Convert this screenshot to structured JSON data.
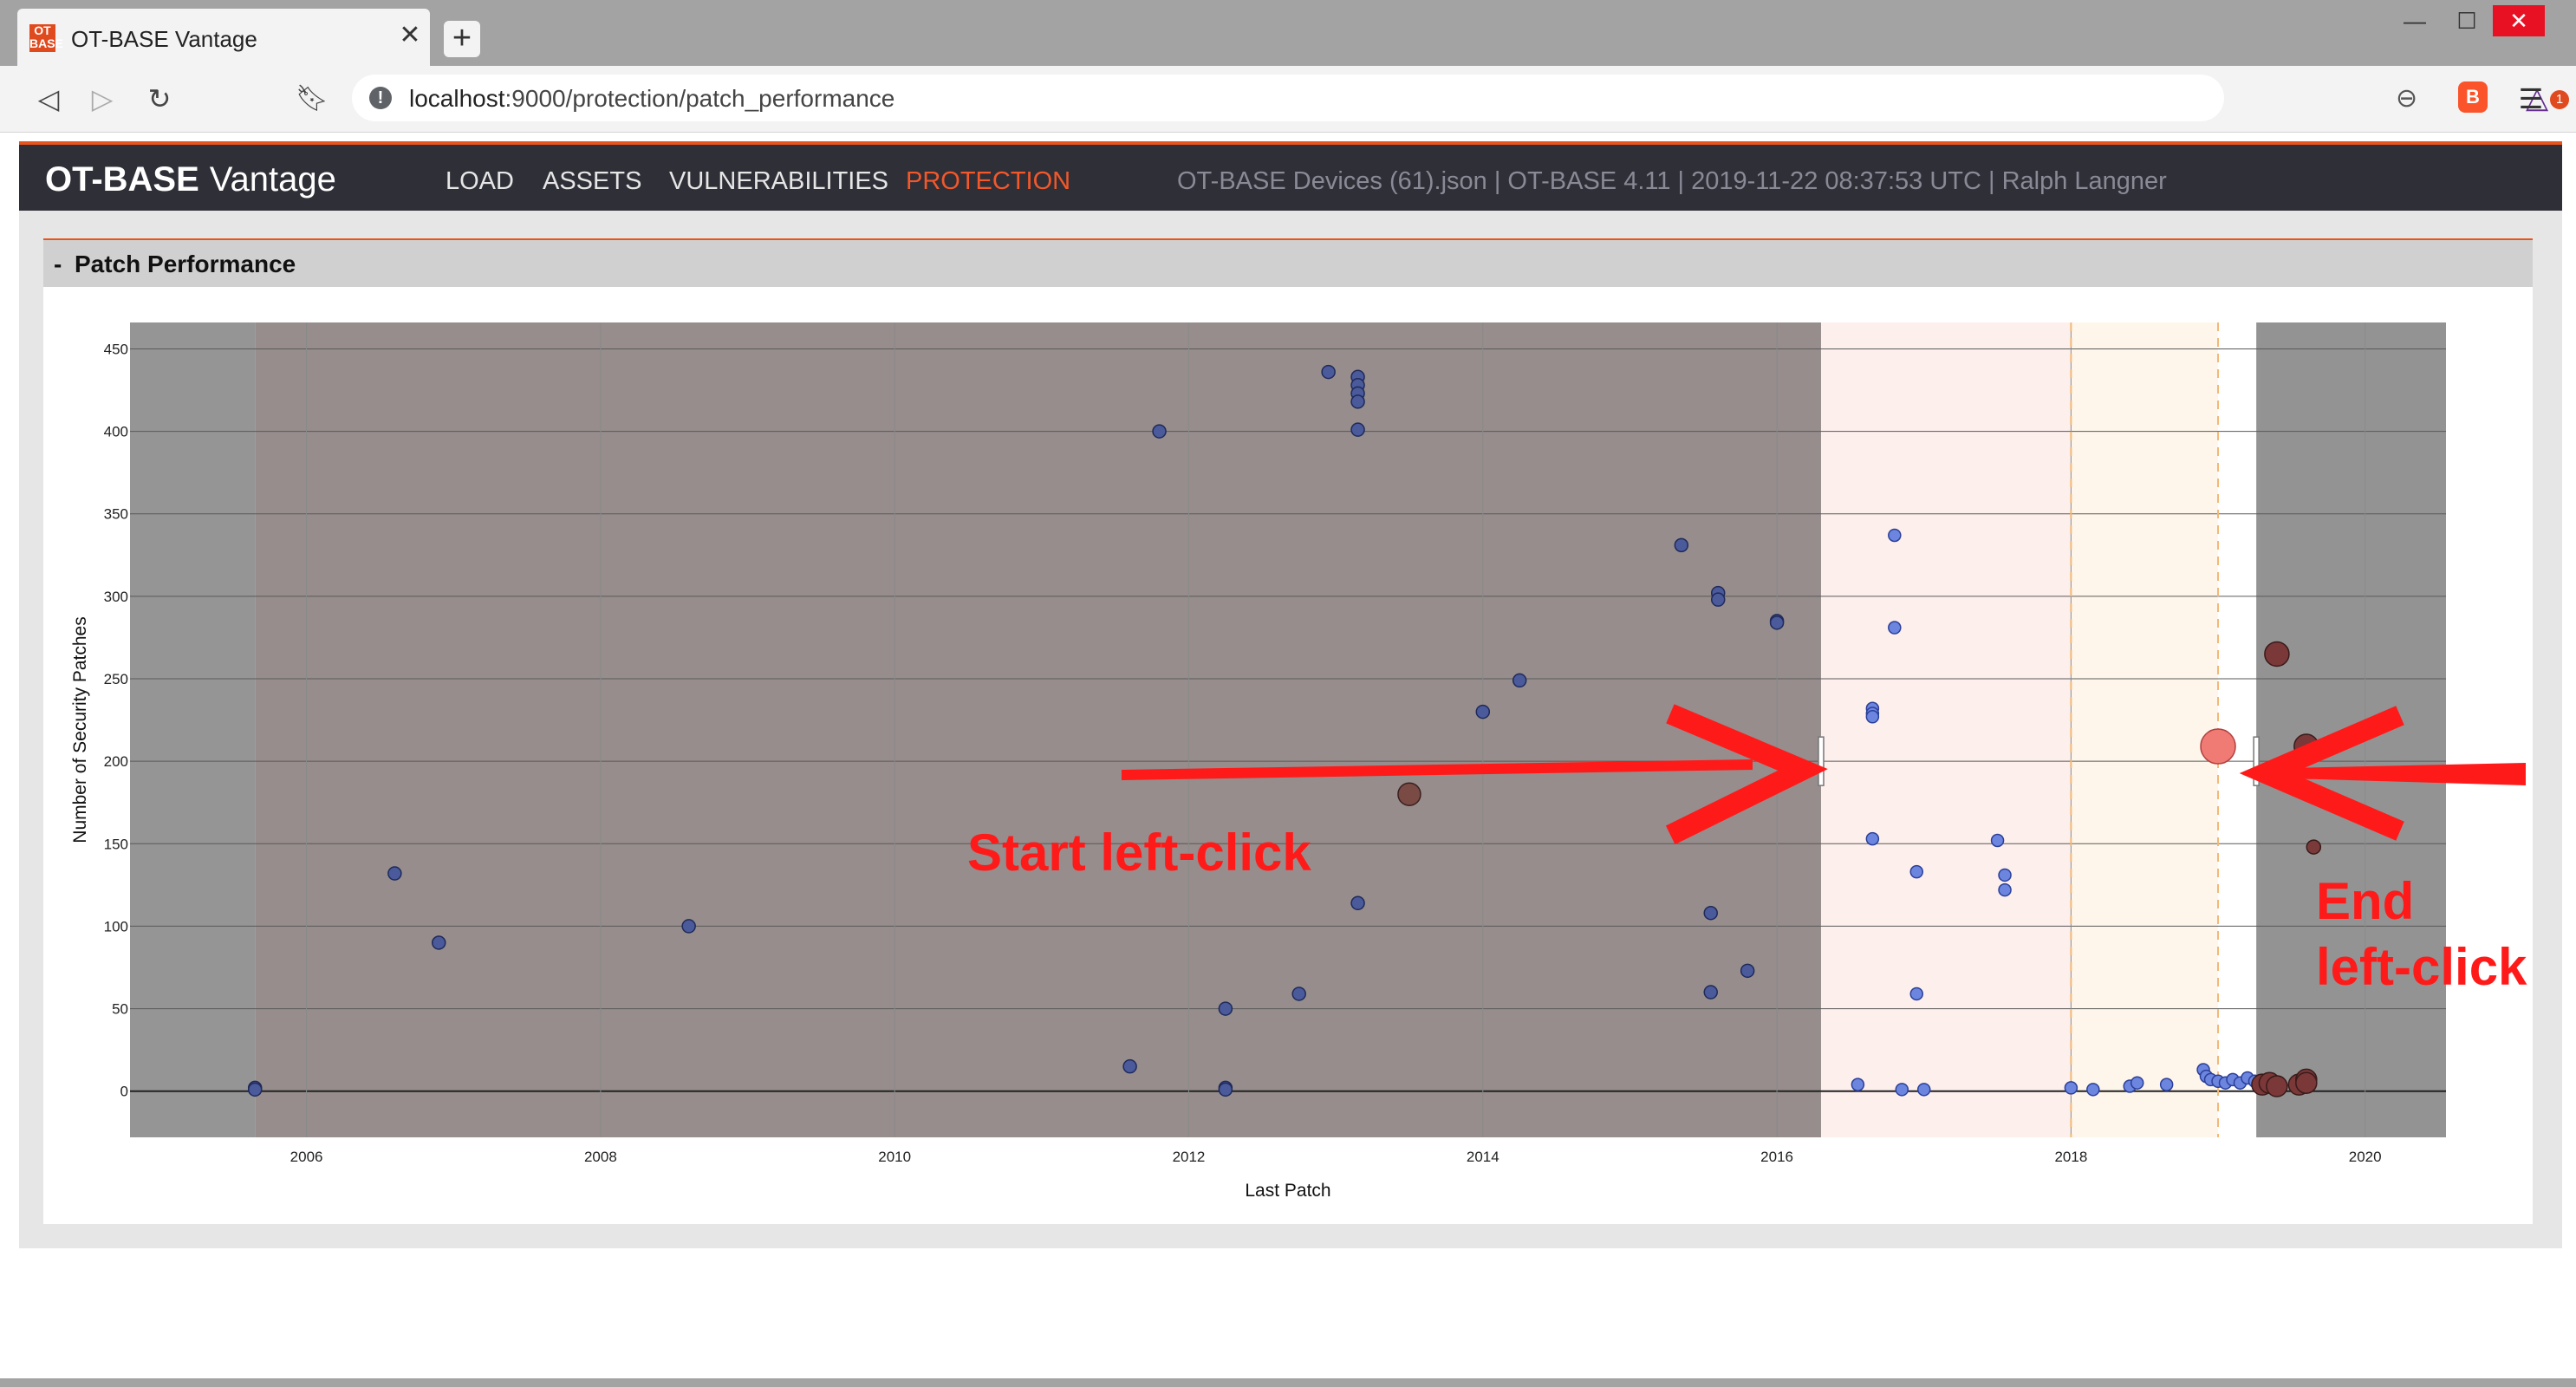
{
  "browser": {
    "tab_title": "OT-BASE Vantage",
    "favicon_text": "OT BASE",
    "new_tab_label": "+",
    "tab_close_label": "✕",
    "url_host": "localhost",
    "url_rest": ":9000/protection/patch_performance",
    "rewards_badge": "1",
    "window_controls": {
      "minimize": "—",
      "maximize": "☐",
      "close": "✕"
    }
  },
  "app": {
    "brand_strong": "OT-BASE",
    "brand_light": "Vantage",
    "nav": [
      "LOAD",
      "ASSETS",
      "VULNERABILITIES",
      "PROTECTION"
    ],
    "active_nav": "PROTECTION",
    "header_info": "OT-BASE Devices (61).json | OT-BASE 4.11 | 2019-11-22 08:37:53 UTC | Ralph Langner",
    "accent_color": "#e8541e"
  },
  "panel": {
    "collapse_symbol": "-",
    "title": "Patch Performance"
  },
  "chart_data": {
    "type": "scatter",
    "xlabel": "Last Patch",
    "ylabel": "Number of Security Patches",
    "x_ticks": [
      "2006",
      "2008",
      "2010",
      "2012",
      "2014",
      "2016",
      "2018",
      "2020"
    ],
    "y_ticks": [
      "0",
      "50",
      "100",
      "150",
      "200",
      "250",
      "300",
      "350",
      "400",
      "450"
    ],
    "xlim": [
      2004.8,
      2020.55
    ],
    "ylim": [
      -28,
      466
    ],
    "regions": {
      "grey": [
        2004.8,
        2005.65
      ],
      "brown": [
        2005.65,
        2016.3
      ],
      "pink": [
        2016.3,
        2018.0
      ],
      "cream": [
        2018.0,
        2019.0
      ],
      "white": [
        2019.0,
        2019.26
      ],
      "dark_grey": [
        2019.26,
        2020.55
      ]
    },
    "dashed_lines_x": [
      2018.0,
      2019.0
    ],
    "selection_x": [
      2016.3,
      2019.26
    ],
    "series": [
      {
        "points": [
          [
            2005.65,
            2
          ],
          [
            2005.65,
            1
          ],
          [
            2006.6,
            132
          ],
          [
            2006.9,
            90
          ],
          [
            2008.6,
            100
          ],
          [
            2011.6,
            15
          ],
          [
            2011.8,
            400
          ],
          [
            2012.25,
            50
          ],
          [
            2012.25,
            2
          ],
          [
            2012.25,
            1
          ],
          [
            2012.75,
            59
          ],
          [
            2012.95,
            436
          ],
          [
            2013.15,
            433
          ],
          [
            2013.15,
            428
          ],
          [
            2013.15,
            423
          ],
          [
            2013.15,
            418
          ],
          [
            2013.15,
            401
          ],
          [
            2013.15,
            114
          ],
          [
            2013.5,
            180
          ],
          [
            2014.0,
            230
          ],
          [
            2014.25,
            249
          ],
          [
            2015.35,
            331
          ],
          [
            2015.55,
            108
          ],
          [
            2015.55,
            60
          ],
          [
            2015.6,
            302
          ],
          [
            2015.6,
            298
          ],
          [
            2015.8,
            73
          ],
          [
            2016.0,
            285
          ],
          [
            2016.0,
            284
          ],
          [
            2016.55,
            4
          ],
          [
            2016.65,
            232
          ],
          [
            2016.65,
            229
          ],
          [
            2016.65,
            227
          ],
          [
            2016.65,
            153
          ],
          [
            2016.8,
            337
          ],
          [
            2016.8,
            281
          ],
          [
            2016.85,
            1
          ],
          [
            2016.95,
            133
          ],
          [
            2016.95,
            59
          ],
          [
            2017.0,
            1
          ],
          [
            2017.5,
            152
          ],
          [
            2017.55,
            131
          ],
          [
            2017.55,
            122
          ],
          [
            2018.0,
            2
          ],
          [
            2018.15,
            1
          ],
          [
            2018.4,
            3
          ],
          [
            2018.45,
            5
          ],
          [
            2018.65,
            4
          ],
          [
            2018.9,
            13
          ],
          [
            2018.92,
            9
          ],
          [
            2018.95,
            7
          ],
          [
            2019.0,
            6
          ],
          [
            2019.05,
            5
          ],
          [
            2019.1,
            7
          ],
          [
            2019.15,
            5
          ],
          [
            2019.2,
            8
          ],
          [
            2019.25,
            6
          ],
          [
            2019.3,
            4
          ],
          [
            2019.35,
            5
          ],
          [
            2019.4,
            3
          ],
          [
            2019.55,
            4
          ],
          [
            2019.6,
            7
          ],
          [
            2019.0,
            209
          ],
          [
            2019.4,
            265
          ],
          [
            2019.6,
            209
          ],
          [
            2019.6,
            5
          ],
          [
            2019.65,
            148
          ]
        ]
      }
    ],
    "annotations": {
      "start": "Start left-click",
      "end_line1": "End",
      "end_line2": "left-click"
    }
  }
}
